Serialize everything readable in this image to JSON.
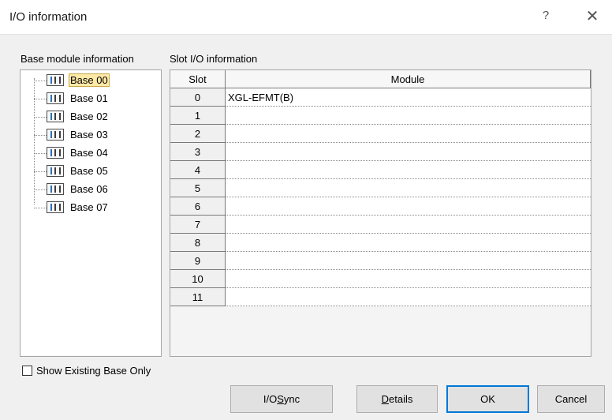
{
  "window": {
    "title": "I/O information",
    "help_label": "?",
    "close_label": "✕"
  },
  "labels": {
    "base_module_information": "Base module information",
    "slot_io_information": "Slot I/O information"
  },
  "tree": {
    "items": [
      "Base 00",
      "Base 01",
      "Base 02",
      "Base 03",
      "Base 04",
      "Base 05",
      "Base 06",
      "Base 07"
    ],
    "selected": "Base 00"
  },
  "table": {
    "headers": {
      "slot": "Slot",
      "module": "Module"
    },
    "rows": [
      {
        "slot": "0",
        "module": "XGL-EFMT(B)"
      },
      {
        "slot": "1",
        "module": ""
      },
      {
        "slot": "2",
        "module": ""
      },
      {
        "slot": "3",
        "module": ""
      },
      {
        "slot": "4",
        "module": ""
      },
      {
        "slot": "5",
        "module": ""
      },
      {
        "slot": "6",
        "module": ""
      },
      {
        "slot": "7",
        "module": ""
      },
      {
        "slot": "8",
        "module": ""
      },
      {
        "slot": "9",
        "module": ""
      },
      {
        "slot": "10",
        "module": ""
      },
      {
        "slot": "11",
        "module": ""
      }
    ]
  },
  "options": {
    "show_existing_base_only": {
      "label": "Show Existing Base Only",
      "checked": false
    }
  },
  "buttons": {
    "io_sync": {
      "pre": "I/O ",
      "key": "S",
      "post": "ync"
    },
    "details": {
      "pre": "",
      "key": "D",
      "post": "etails"
    },
    "ok": "OK",
    "cancel": "Cancel"
  },
  "colors": {
    "selection_highlight": "#ffe9a6",
    "default_button_border": "#0078d7",
    "dialog_background": "#f0f0f0"
  },
  "icons": {
    "tree_item": "base-rack-icon"
  }
}
